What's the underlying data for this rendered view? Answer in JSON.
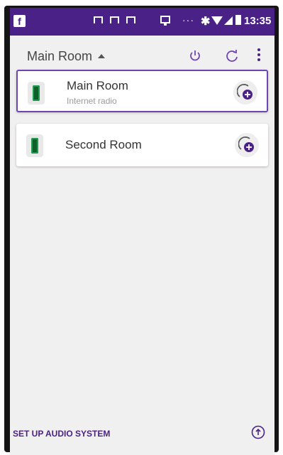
{
  "status_bar": {
    "time": "13:35",
    "icons": [
      "facebook-icon",
      "notification-icon",
      "notification-icon",
      "notification-icon",
      "screen-cast-icon",
      "more-dots-icon",
      "bluetooth-icon",
      "wifi-icon",
      "signal-icon",
      "battery-icon"
    ]
  },
  "app_bar": {
    "room_selector": "Main Room",
    "icons": [
      "power-icon",
      "refresh-icon",
      "overflow-menu-icon"
    ]
  },
  "rooms": [
    {
      "name": "Main Room",
      "subtitle": "Internet radio",
      "selected": true
    },
    {
      "name": "Second Room",
      "subtitle": "",
      "selected": false
    }
  ],
  "footer": {
    "setup_label": "SET UP AUDIO SYSTEM",
    "icon": "up-arrow-circle-icon"
  },
  "colors": {
    "primary": "#4a2287",
    "accent": "#6f45b4",
    "background": "#f1f0f0"
  }
}
